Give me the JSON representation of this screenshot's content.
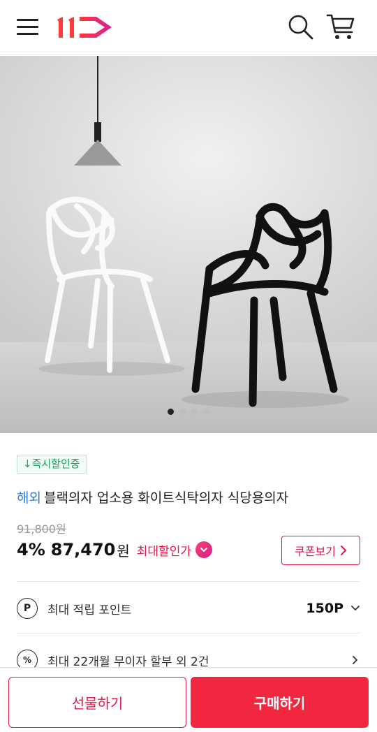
{
  "header": {
    "menu_icon": "hamburger-menu-icon",
    "logo_text": "11",
    "search_icon": "search-icon",
    "cart_icon": "cart-icon",
    "brand_color": "#e6154a"
  },
  "gallery": {
    "image_description": "Product photo: white and black curved-frame chairs under a pendant lamp",
    "total_slides": 4,
    "active_slide": 1
  },
  "product": {
    "badge": "↓즉시할인중",
    "overseas_tag": "해외",
    "title": "블랙의자 업소용 화이트식탁의자 식당용의자",
    "original_price": "91,800원",
    "discount_rate": "4%",
    "sale_price": "87,470",
    "currency": "원",
    "max_discount_label": "최대할인가",
    "coupon_button": "쿠폰보기"
  },
  "benefits": {
    "points_icon_char": "P",
    "points_label": "최대 적립 포인트",
    "points_value": "150P",
    "installment_icon_char": "%",
    "installment_label": "최대 22개월 무이자 할부 외 2건"
  },
  "actions": {
    "gift_label": "선물하기",
    "buy_label": "구매하기"
  }
}
